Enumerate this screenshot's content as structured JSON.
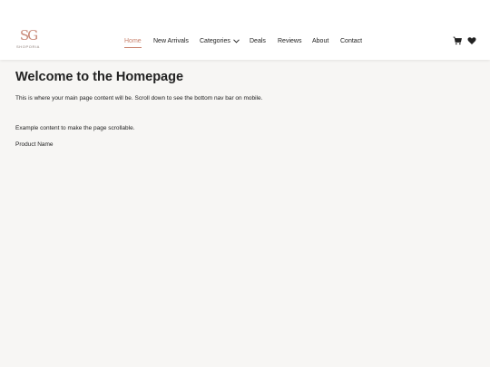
{
  "brand": {
    "logo_mark": "SG",
    "logo_text": "SHOPORIA"
  },
  "nav": {
    "items": [
      {
        "label": "Home"
      },
      {
        "label": "New Arrivals"
      },
      {
        "label": "Categories"
      },
      {
        "label": "Deals"
      },
      {
        "label": "Reviews"
      },
      {
        "label": "About"
      },
      {
        "label": "Contact"
      }
    ],
    "active_index": 0
  },
  "icons": {
    "cart": "cart-icon",
    "wishlist": "heart-icon"
  },
  "colors": {
    "accent": "#c9826d",
    "background": "#f7f6f4",
    "header": "#ffffff",
    "text": "#222222"
  },
  "main": {
    "heading": "Welcome to the Homepage",
    "intro": "This is where your main page content will be. Scroll down to see the bottom nav bar on mobile.",
    "example": "Example content to make the page scrollable.",
    "product": "Product Name"
  }
}
